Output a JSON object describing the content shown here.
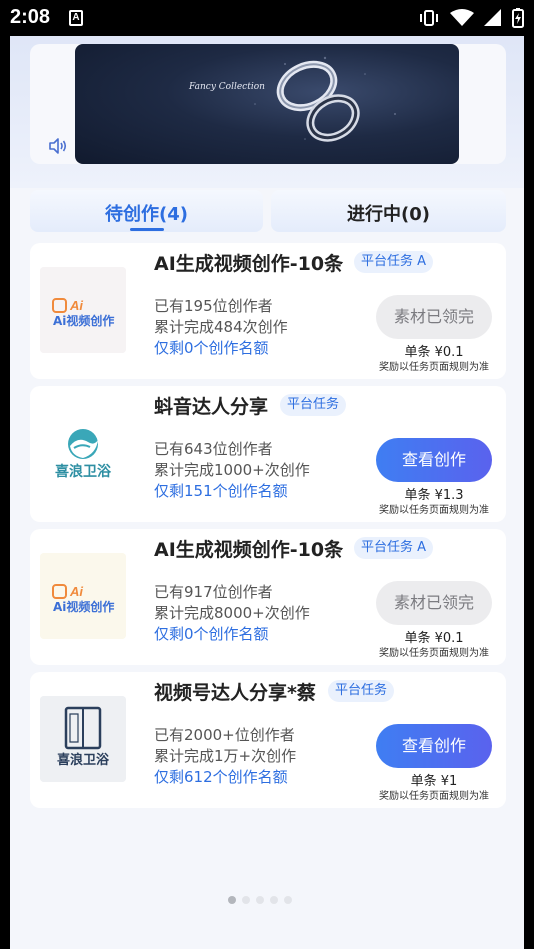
{
  "status_bar": {
    "time": "2:08",
    "notification_glyph": "A",
    "icons": [
      "vibrate-icon",
      "wifi-icon",
      "signal-icon",
      "battery-charging-icon"
    ]
  },
  "banner": {
    "title": "Fancy Collection",
    "subtitle": "",
    "has_sound_toggle": true
  },
  "tabs": [
    {
      "label": "待创作(4)",
      "active": true
    },
    {
      "label": "进行中(0)",
      "active": false
    }
  ],
  "tasks": [
    {
      "title": "AI生成视频创作-10条",
      "badge": "平台任务 A",
      "creators": "已有195位创作者",
      "completed": "累计完成484次创作",
      "remaining": "仅剩0个创作名额",
      "button": "素材已领完",
      "button_enabled": false,
      "price": "单条 ¥0.1",
      "note": "奖励以任务页面规则为准",
      "thumb": "ai-video-logo",
      "thumb_text": "Ai视频创作"
    },
    {
      "title": "蚪音达人分享",
      "badge": "平台任务",
      "creators": "已有643位创作者",
      "completed": "累计完成1000+次创作",
      "remaining": "仅剩151个创作名额",
      "button": "查看创作",
      "button_enabled": true,
      "price": "单条 ¥1.3",
      "note": "奖励以任务页面规则为准",
      "thumb": "xilang-wave-logo",
      "thumb_text": "喜浪卫浴"
    },
    {
      "title": "AI生成视频创作-10条",
      "badge": "平台任务 A",
      "creators": "已有917位创作者",
      "completed": "累计完成8000+次创作",
      "remaining": "仅剩0个创作名额",
      "button": "素材已领完",
      "button_enabled": false,
      "price": "单条 ¥0.1",
      "note": "奖励以任务页面规则为准",
      "thumb": "ai-video-logo",
      "thumb_text": "Ai视频创作"
    },
    {
      "title": "视频号达人分享*蔡",
      "badge": "平台任务",
      "creators": "已有2000+位创作者",
      "completed": "累计完成1万+次创作",
      "remaining": "仅剩612个创作名额",
      "button": "查看创作",
      "button_enabled": true,
      "price": "单条 ¥1",
      "note": "奖励以任务页面规则为准",
      "thumb": "xilang-shower-logo",
      "thumb_text": "喜浪卫浴"
    }
  ],
  "colors": {
    "accent": "#2d6ee0",
    "button_gradient_start": "#3f7ef2",
    "button_gradient_end": "#5a62ee",
    "disabled_button": "#ececee",
    "page_background": "#f4f6fb"
  },
  "pagination": {
    "count": 5,
    "active_index": 0
  }
}
